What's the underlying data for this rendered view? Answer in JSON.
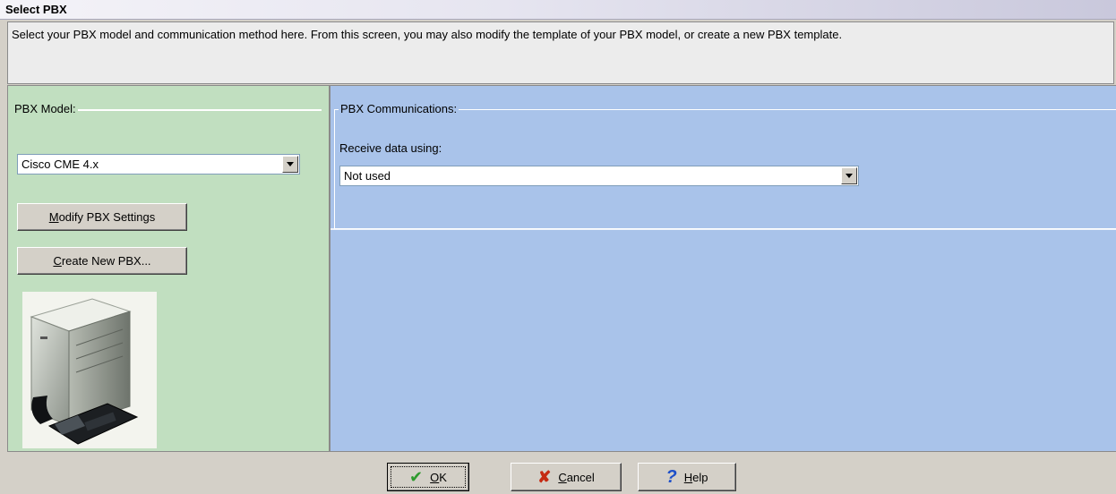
{
  "window": {
    "title": "Select PBX"
  },
  "description": "Select your PBX model and communication method here.  From this screen, you may also modify the template of your PBX model, or create a new PBX template.",
  "pbx_model": {
    "group_label": "PBX Model:",
    "selected_model": "Cisco CME 4.x",
    "modify_button": {
      "mnemonic": "M",
      "rest": "odify PBX Settings"
    },
    "create_button": {
      "mnemonic": "C",
      "rest": "reate New PBX..."
    }
  },
  "pbx_communications": {
    "group_label": "PBX Communications:",
    "receive_label": "Receive data using:",
    "receive_value": "Not used"
  },
  "buttons": {
    "ok": {
      "mnemonic": "O",
      "rest": "K"
    },
    "cancel": {
      "mnemonic": "C",
      "rest": "ancel"
    },
    "help": {
      "mnemonic": "H",
      "rest": "elp"
    }
  },
  "icons": {
    "ok": "checkmark-icon",
    "cancel": "x-icon",
    "help": "question-icon",
    "dropdown": "chevron-down-icon"
  },
  "colors": {
    "left_pane": "#c1dfc0",
    "right_pane": "#a9c3ea",
    "ok_check": "#2e9a2e",
    "cancel_x": "#c52a12",
    "help_q": "#1d4fc9"
  }
}
